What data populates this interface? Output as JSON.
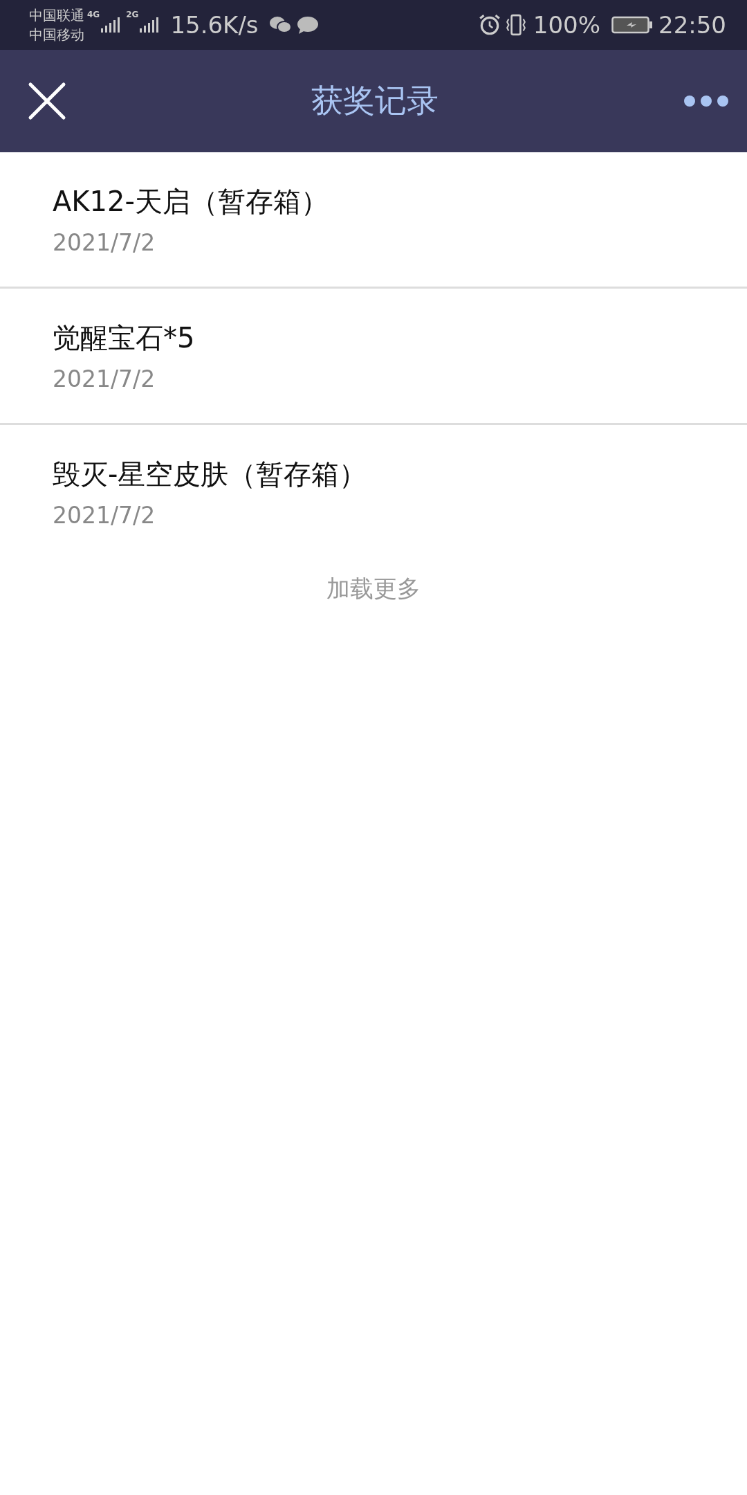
{
  "status_bar": {
    "carriers": [
      "中国联通",
      "中国移动"
    ],
    "network_1": "4G",
    "network_2": "2G",
    "speed": "15.6K/s",
    "battery": "100%",
    "time": "22:50"
  },
  "header": {
    "title": "获奖记录"
  },
  "records": [
    {
      "name": "AK12-天启（暂存箱）",
      "date": "2021/7/2"
    },
    {
      "name": "觉醒宝石*5",
      "date": "2021/7/2"
    },
    {
      "name": "毁灭-星空皮肤（暂存箱）",
      "date": "2021/7/2"
    }
  ],
  "load_more": "加载更多"
}
